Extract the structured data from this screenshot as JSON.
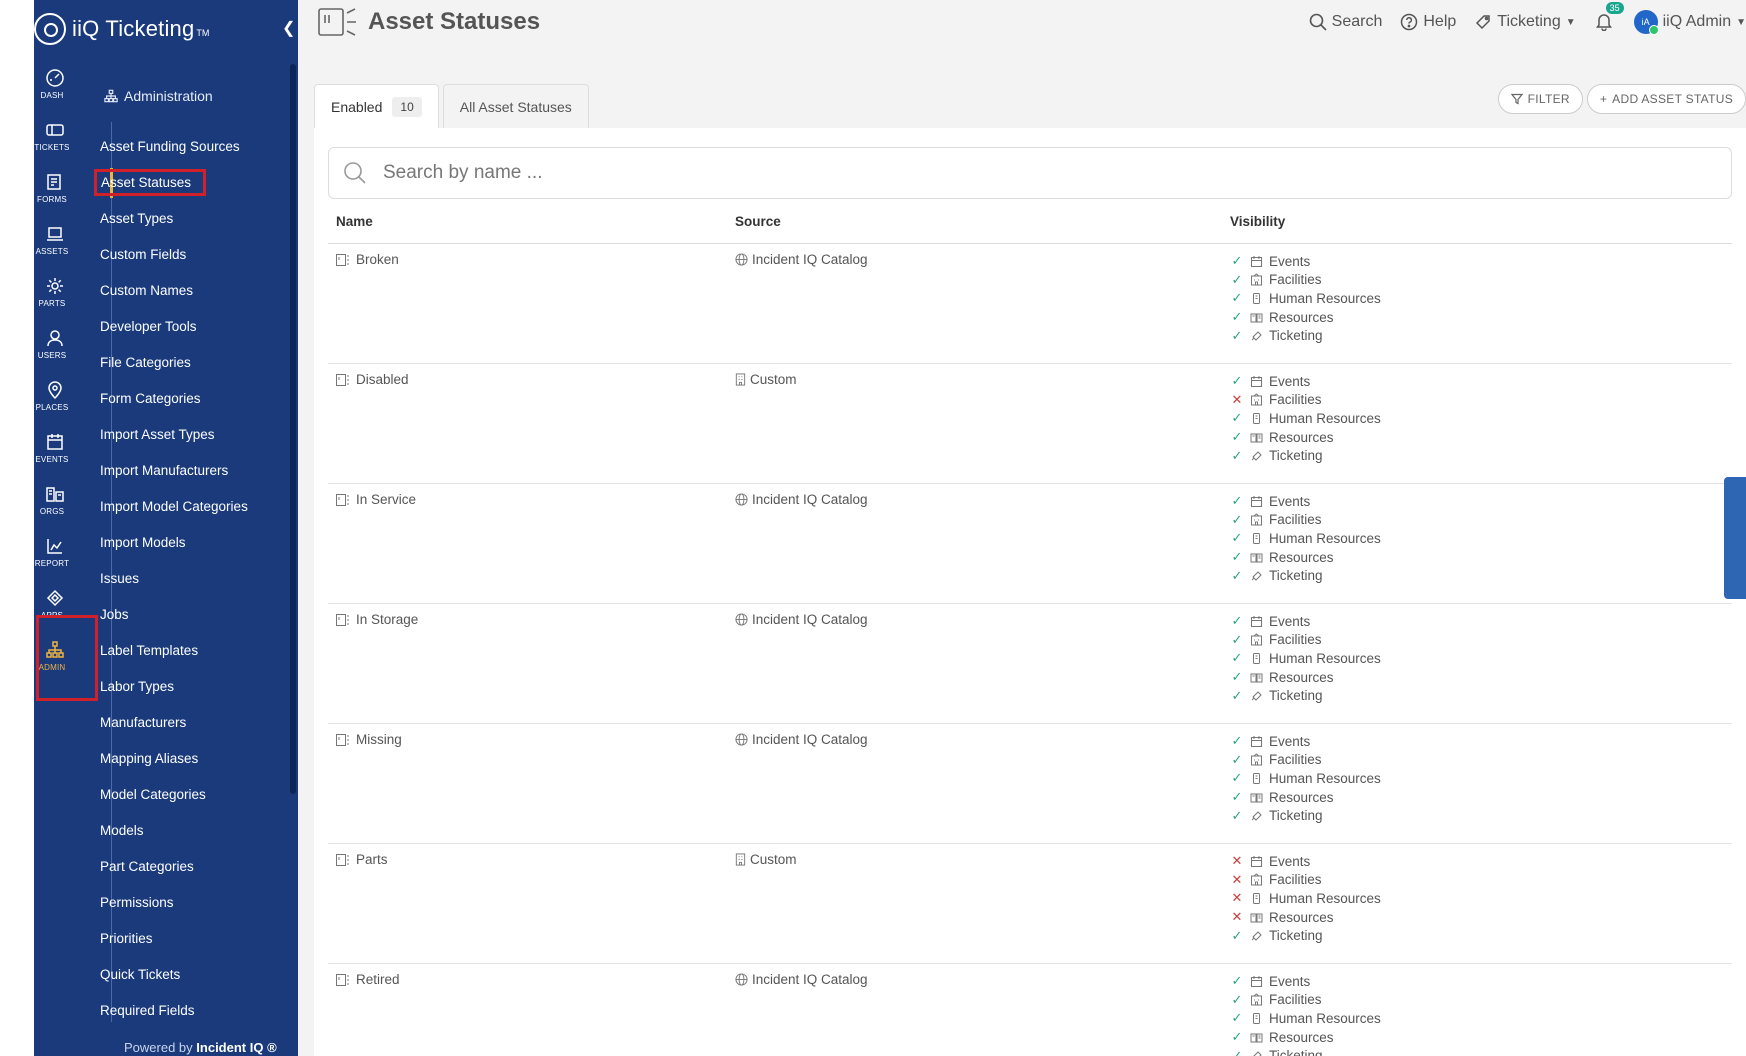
{
  "app": {
    "name": "iiQ Ticketing",
    "tm": "TM",
    "powered_by_prefix": "Powered by",
    "powered_by_brand": "Incident IQ ®"
  },
  "rail": [
    {
      "label": "DASH",
      "icon": "dashboard-icon"
    },
    {
      "label": "TICKETS",
      "icon": "ticket-icon"
    },
    {
      "label": "FORMS",
      "icon": "forms-icon"
    },
    {
      "label": "ASSETS",
      "icon": "laptop-icon"
    },
    {
      "label": "PARTS",
      "icon": "gear-icon"
    },
    {
      "label": "USERS",
      "icon": "user-icon"
    },
    {
      "label": "PLACES",
      "icon": "location-pin-icon"
    },
    {
      "label": "EVENTS",
      "icon": "calendar-icon"
    },
    {
      "label": "ORGS",
      "icon": "building-icon"
    },
    {
      "label": "REPORT",
      "icon": "chart-icon"
    },
    {
      "label": "APPS",
      "icon": "apps-icon"
    },
    {
      "label": "ADMIN",
      "icon": "org-chart-icon"
    }
  ],
  "sidebar": {
    "section": "Administration",
    "items": [
      "Asset Funding Sources",
      "Asset Statuses",
      "Asset Types",
      "Custom Fields",
      "Custom Names",
      "Developer Tools",
      "File Categories",
      "Form Categories",
      "Import Asset Types",
      "Import Manufacturers",
      "Import Model Categories",
      "Import Models",
      "Issues",
      "Jobs",
      "Label Templates",
      "Labor Types",
      "Manufacturers",
      "Mapping Aliases",
      "Model Categories",
      "Models",
      "Part Categories",
      "Permissions",
      "Priorities",
      "Quick Tickets",
      "Required Fields"
    ]
  },
  "header": {
    "title": "Asset Statuses",
    "search": "Search",
    "help": "Help",
    "product": "Ticketing",
    "notifications": "35",
    "user_initials": "iA",
    "user": "iiQ Admin"
  },
  "tabs": {
    "enabled": "Enabled",
    "enabled_count": "10",
    "all": "All Asset Statuses"
  },
  "buttons": {
    "filter": "FILTER",
    "add": "ADD ASSET STATUS"
  },
  "search": {
    "placeholder": "Search by name ..."
  },
  "table": {
    "columns": [
      "Name",
      "Source",
      "Visibility"
    ],
    "visibility_labels": [
      "Events",
      "Facilities",
      "Human Resources",
      "Resources",
      "Ticketing"
    ],
    "rows": [
      {
        "name": "Broken",
        "source": "Incident IQ Catalog",
        "source_type": "globe",
        "vis": [
          true,
          true,
          true,
          true,
          true
        ]
      },
      {
        "name": "Disabled",
        "source": "Custom",
        "source_type": "custom",
        "vis": [
          true,
          false,
          true,
          true,
          true
        ]
      },
      {
        "name": "In Service",
        "source": "Incident IQ Catalog",
        "source_type": "globe",
        "vis": [
          true,
          true,
          true,
          true,
          true
        ]
      },
      {
        "name": "In Storage",
        "source": "Incident IQ Catalog",
        "source_type": "globe",
        "vis": [
          true,
          true,
          true,
          true,
          true
        ]
      },
      {
        "name": "Missing",
        "source": "Incident IQ Catalog",
        "source_type": "globe",
        "vis": [
          true,
          true,
          true,
          true,
          true
        ]
      },
      {
        "name": "Parts",
        "source": "Custom",
        "source_type": "custom",
        "vis": [
          false,
          false,
          false,
          false,
          true
        ]
      },
      {
        "name": "Retired",
        "source": "Incident IQ Catalog",
        "source_type": "globe",
        "vis": [
          true,
          true,
          true,
          true,
          true
        ]
      }
    ]
  },
  "colors": {
    "sidebar": "#1a3a7c",
    "active_accent": "#f0b33e",
    "highlight": "#d0202a",
    "check": "#2aa37a",
    "cross": "#c94040"
  }
}
